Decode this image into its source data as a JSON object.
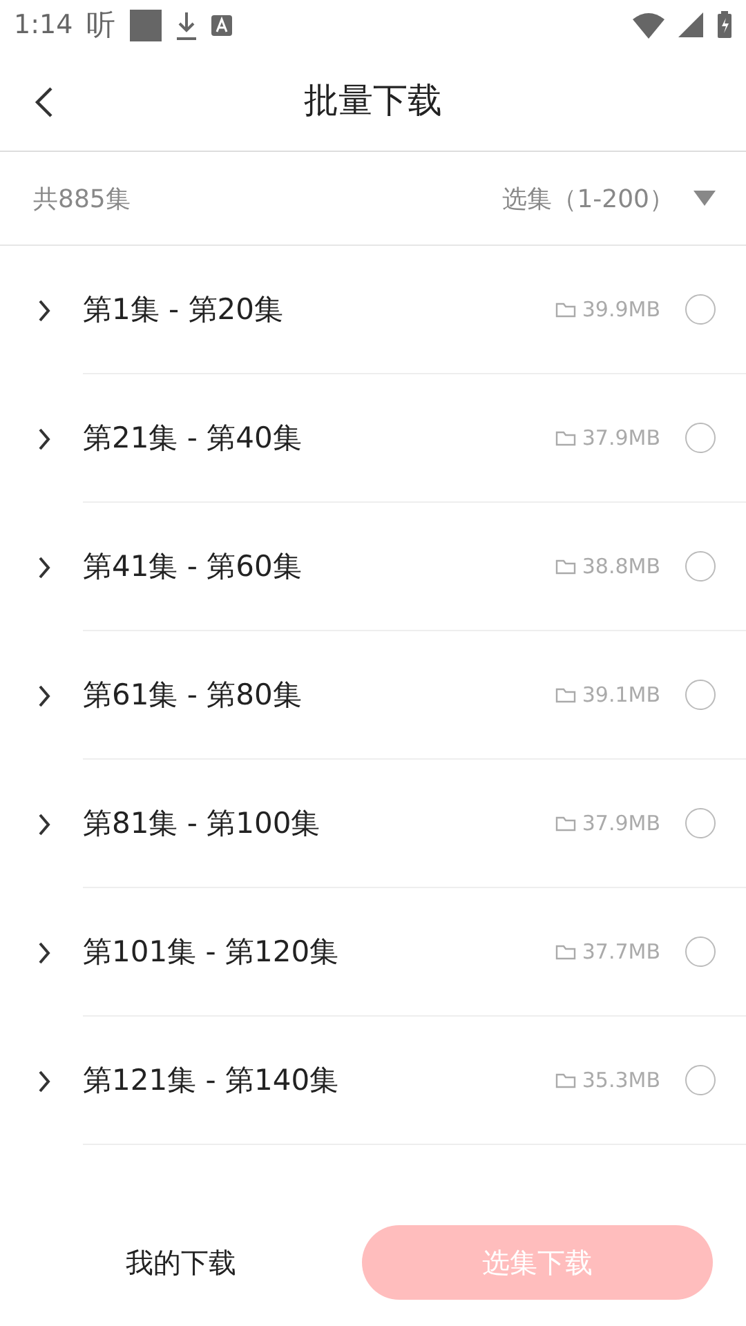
{
  "status_bar": {
    "time": "1:14",
    "app_glyph": "听"
  },
  "header": {
    "title": "批量下载"
  },
  "summary": {
    "total": "共885集",
    "range_selector": "选集（1-200）"
  },
  "groups": [
    {
      "label": "第1集 - 第20集",
      "size": "39.9MB",
      "expanded": false,
      "selected": false
    },
    {
      "label": "第21集 - 第40集",
      "size": "37.9MB",
      "expanded": false,
      "selected": false
    },
    {
      "label": "第41集 - 第60集",
      "size": "38.8MB",
      "expanded": false,
      "selected": false
    },
    {
      "label": "第61集 - 第80集",
      "size": "39.1MB",
      "expanded": false,
      "selected": false
    },
    {
      "label": "第81集 - 第100集",
      "size": "37.9MB",
      "expanded": false,
      "selected": false
    },
    {
      "label": "第101集 - 第120集",
      "size": "37.7MB",
      "expanded": false,
      "selected": false
    },
    {
      "label": "第121集 - 第140集",
      "size": "35.3MB",
      "expanded": false,
      "selected": false
    }
  ],
  "bottom_bar": {
    "my_downloads": "我的下载",
    "download_button": {
      "label": "选集下载",
      "disabled": true
    }
  }
}
